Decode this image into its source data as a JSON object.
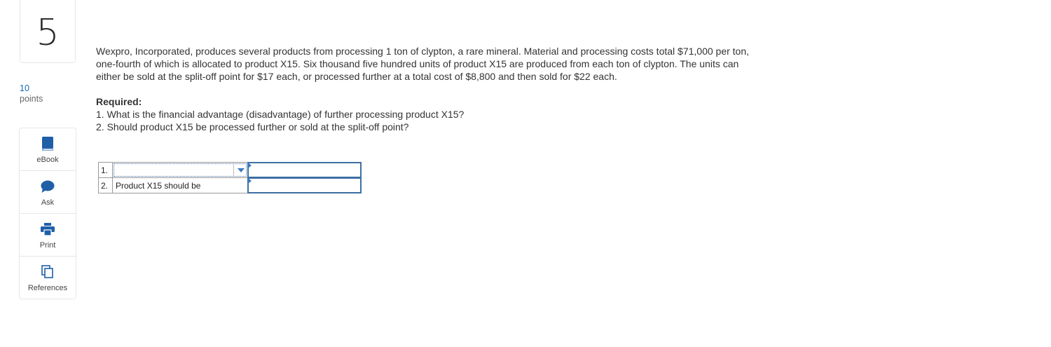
{
  "question": {
    "number": "5",
    "points_value": "10",
    "points_label": "points"
  },
  "tools": [
    {
      "label": "eBook",
      "icon": "book-icon"
    },
    {
      "label": "Ask",
      "icon": "chat-bubble-icon"
    },
    {
      "label": "Print",
      "icon": "printer-icon"
    },
    {
      "label": "References",
      "icon": "documents-icon"
    }
  ],
  "problem": {
    "text": "Wexpro, Incorporated, produces several products from processing 1 ton of clypton, a rare mineral. Material and processing costs total $71,000 per ton, one-fourth of which is allocated to product X15. Six thousand five hundred units of product X15 are produced from each ton of clypton. The units can either be sold at the split-off point for $17 each, or processed further at a total cost of $8,800 and then sold for $22 each.",
    "required_title": "Required:",
    "requirements": [
      "1. What is the financial advantage (disadvantage) of further processing product X15?",
      "2. Should product X15 be processed further or sold at the split-off point?"
    ]
  },
  "answer_table": {
    "rows": [
      {
        "num": "1.",
        "label": "",
        "selected_value": "",
        "input_value": ""
      },
      {
        "num": "2.",
        "label": "Product X15 should be",
        "input_value": ""
      }
    ]
  },
  "colors": {
    "accent_blue": "#1a66b3",
    "icon_blue": "#3b79c2",
    "input_border": "#3d6fa3"
  }
}
